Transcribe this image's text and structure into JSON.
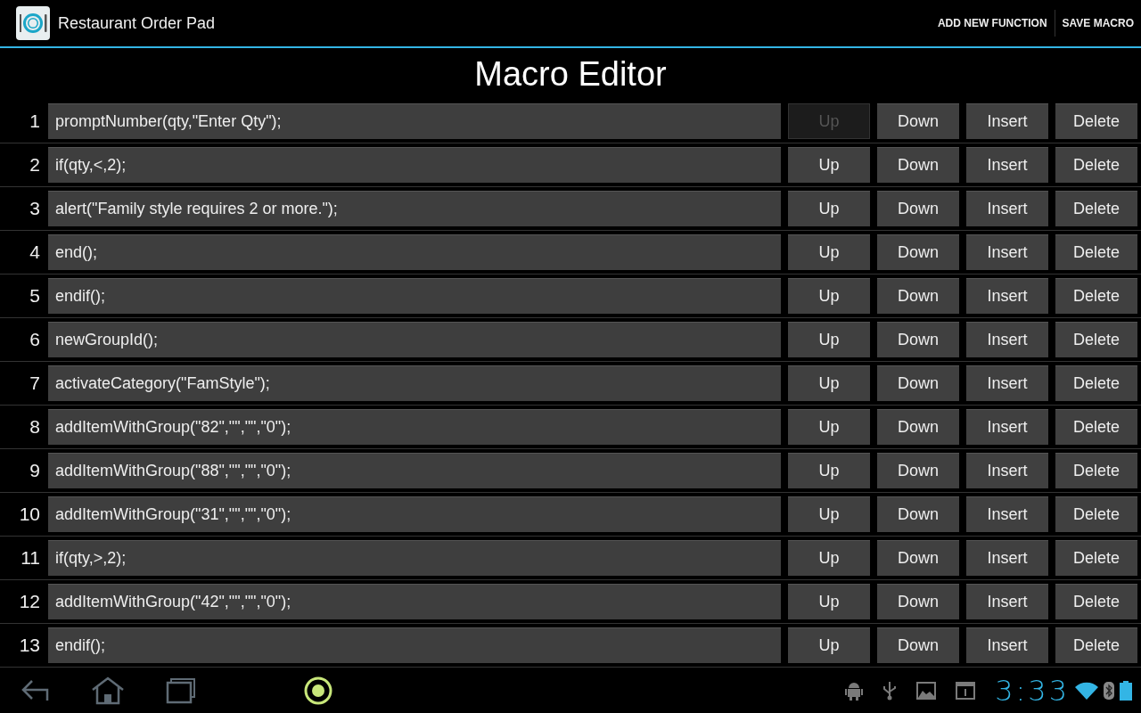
{
  "action_bar": {
    "title": "Restaurant Order Pad",
    "actions": [
      "ADD NEW FUNCTION",
      "SAVE MACRO"
    ]
  },
  "heading": "Macro Editor",
  "rows": [
    {
      "number": "1",
      "code": "promptNumber(qty,\"Enter Qty\");",
      "buttons": [
        {
          "label": "Up",
          "disabled": true
        },
        {
          "label": "Down",
          "disabled": false
        },
        {
          "label": "Insert",
          "disabled": false
        },
        {
          "label": "Delete",
          "disabled": false
        }
      ]
    },
    {
      "number": "2",
      "code": "if(qty,<,2);",
      "buttons": [
        {
          "label": "Up",
          "disabled": false
        },
        {
          "label": "Down",
          "disabled": false
        },
        {
          "label": "Insert",
          "disabled": false
        },
        {
          "label": "Delete",
          "disabled": false
        }
      ]
    },
    {
      "number": "3",
      "code": "alert(\"Family style requires 2 or more.\");",
      "buttons": [
        {
          "label": "Up",
          "disabled": false
        },
        {
          "label": "Down",
          "disabled": false
        },
        {
          "label": "Insert",
          "disabled": false
        },
        {
          "label": "Delete",
          "disabled": false
        }
      ]
    },
    {
      "number": "4",
      "code": "end();",
      "buttons": [
        {
          "label": "Up",
          "disabled": false
        },
        {
          "label": "Down",
          "disabled": false
        },
        {
          "label": "Insert",
          "disabled": false
        },
        {
          "label": "Delete",
          "disabled": false
        }
      ]
    },
    {
      "number": "5",
      "code": "endif();",
      "buttons": [
        {
          "label": "Up",
          "disabled": false
        },
        {
          "label": "Down",
          "disabled": false
        },
        {
          "label": "Insert",
          "disabled": false
        },
        {
          "label": "Delete",
          "disabled": false
        }
      ]
    },
    {
      "number": "6",
      "code": "newGroupId();",
      "buttons": [
        {
          "label": "Up",
          "disabled": false
        },
        {
          "label": "Down",
          "disabled": false
        },
        {
          "label": "Insert",
          "disabled": false
        },
        {
          "label": "Delete",
          "disabled": false
        }
      ]
    },
    {
      "number": "7",
      "code": "activateCategory(\"FamStyle\");",
      "buttons": [
        {
          "label": "Up",
          "disabled": false
        },
        {
          "label": "Down",
          "disabled": false
        },
        {
          "label": "Insert",
          "disabled": false
        },
        {
          "label": "Delete",
          "disabled": false
        }
      ]
    },
    {
      "number": "8",
      "code": "addItemWithGroup(\"82\",\"\",\"\",\"0\");",
      "buttons": [
        {
          "label": "Up",
          "disabled": false
        },
        {
          "label": "Down",
          "disabled": false
        },
        {
          "label": "Insert",
          "disabled": false
        },
        {
          "label": "Delete",
          "disabled": false
        }
      ]
    },
    {
      "number": "9",
      "code": "addItemWithGroup(\"88\",\"\",\"\",\"0\");",
      "buttons": [
        {
          "label": "Up",
          "disabled": false
        },
        {
          "label": "Down",
          "disabled": false
        },
        {
          "label": "Insert",
          "disabled": false
        },
        {
          "label": "Delete",
          "disabled": false
        }
      ]
    },
    {
      "number": "10",
      "code": "addItemWithGroup(\"31\",\"\",\"\",\"0\");",
      "buttons": [
        {
          "label": "Up",
          "disabled": false
        },
        {
          "label": "Down",
          "disabled": false
        },
        {
          "label": "Insert",
          "disabled": false
        },
        {
          "label": "Delete",
          "disabled": false
        }
      ]
    },
    {
      "number": "11",
      "code": "if(qty,>,2);",
      "buttons": [
        {
          "label": "Up",
          "disabled": false
        },
        {
          "label": "Down",
          "disabled": false
        },
        {
          "label": "Insert",
          "disabled": false
        },
        {
          "label": "Delete",
          "disabled": false
        }
      ]
    },
    {
      "number": "12",
      "code": "addItemWithGroup(\"42\",\"\",\"\",\"0\");",
      "buttons": [
        {
          "label": "Up",
          "disabled": false
        },
        {
          "label": "Down",
          "disabled": false
        },
        {
          "label": "Insert",
          "disabled": false
        },
        {
          "label": "Delete",
          "disabled": false
        }
      ]
    },
    {
      "number": "13",
      "code": "endif();",
      "buttons": [
        {
          "label": "Up",
          "disabled": false
        },
        {
          "label": "Down",
          "disabled": false
        },
        {
          "label": "Insert",
          "disabled": false
        },
        {
          "label": "Delete",
          "disabled": false
        }
      ]
    }
  ],
  "system_bar": {
    "time": "3:33"
  }
}
